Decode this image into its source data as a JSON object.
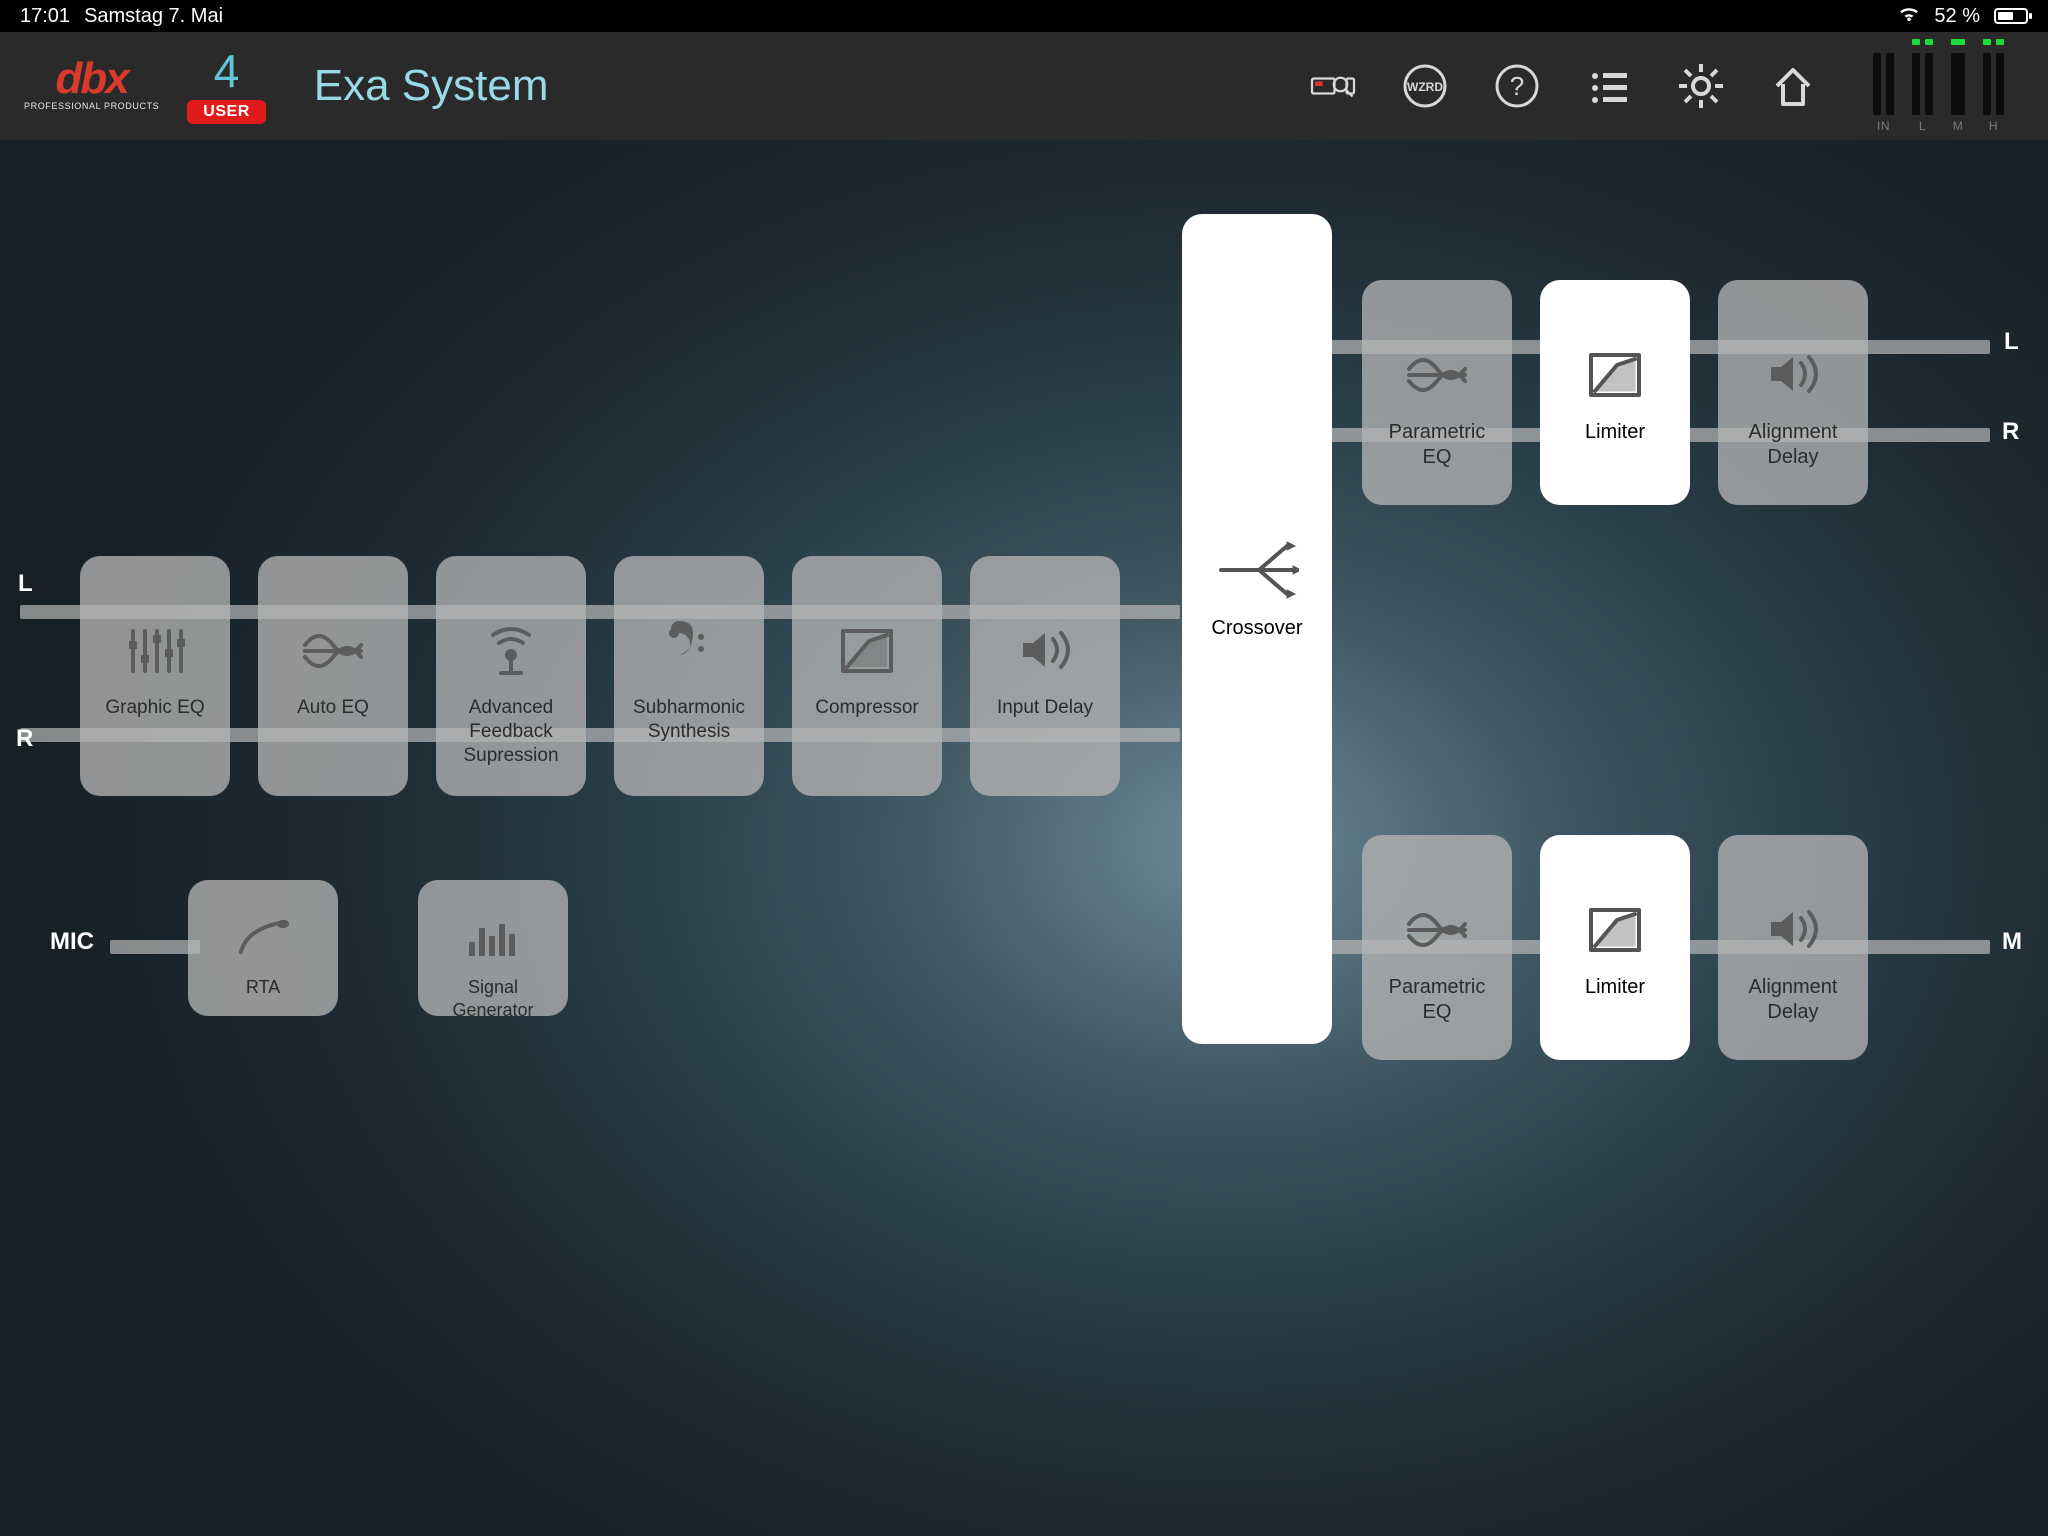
{
  "statusbar": {
    "time": "17:01",
    "date": "Samstag 7. Mai",
    "battery_pct": "52 %"
  },
  "header": {
    "logo_main": "dbx",
    "logo_tag": "PROFESSIONAL PRODUCTS",
    "preset_number": "4",
    "preset_label": "USER",
    "system_title": "Exa System",
    "meters": {
      "in": "IN",
      "l": "L",
      "m": "M",
      "h": "H"
    }
  },
  "labels": {
    "channel_L": "L",
    "channel_R": "R",
    "channel_MIC": "MIC",
    "out_L": "L",
    "out_R": "R",
    "out_M": "M"
  },
  "input_chain": [
    {
      "name": "Graphic EQ",
      "icon": "sliders"
    },
    {
      "name": "Auto EQ",
      "icon": "wave"
    },
    {
      "name": "Advanced Feedback Supression",
      "icon": "mic-fb"
    },
    {
      "name": "Subharmonic Synthesis",
      "icon": "bass"
    },
    {
      "name": "Compressor",
      "icon": "comp"
    },
    {
      "name": "Input Delay",
      "icon": "delay"
    }
  ],
  "mic_chain": [
    {
      "name": "RTA",
      "icon": "rta"
    },
    {
      "name": "Signal Generator",
      "icon": "bars"
    }
  ],
  "crossover": {
    "name": "Crossover",
    "icon": "split"
  },
  "output_chain_top": [
    {
      "name": "Parametric EQ",
      "icon": "wave",
      "active": false
    },
    {
      "name": "Limiter",
      "icon": "comp",
      "active": true
    },
    {
      "name": "Alignment Delay",
      "icon": "delay",
      "active": false
    }
  ],
  "output_chain_bottom": [
    {
      "name": "Parametric EQ",
      "icon": "wave",
      "active": false
    },
    {
      "name": "Limiter",
      "icon": "comp",
      "active": true
    },
    {
      "name": "Alignment Delay",
      "icon": "delay",
      "active": false
    }
  ]
}
